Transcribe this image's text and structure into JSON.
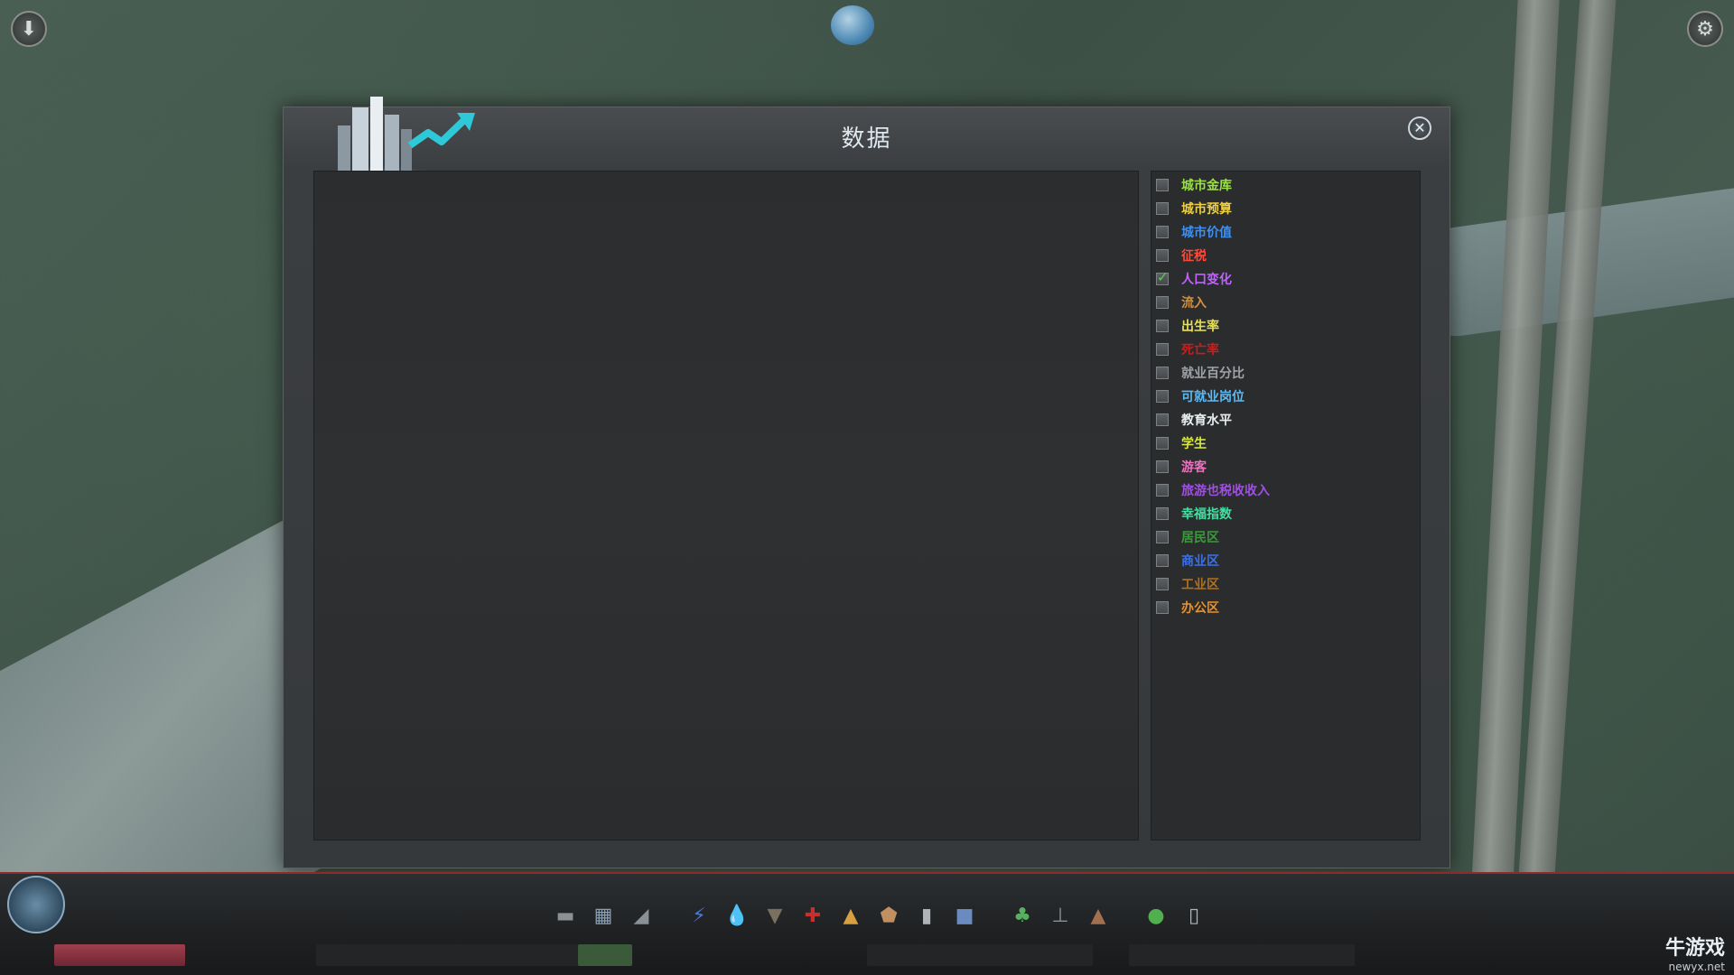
{
  "panel": {
    "title": "数据",
    "close_label": "✕"
  },
  "legend": {
    "items": [
      {
        "label": "城市金库",
        "color": "#9be04a",
        "checked": false
      },
      {
        "label": "城市预算",
        "color": "#f0d040",
        "checked": false
      },
      {
        "label": "城市价值",
        "color": "#3f8ff0",
        "checked": false
      },
      {
        "label": "征税",
        "color": "#ff4a3a",
        "checked": false
      },
      {
        "label": "人口变化",
        "color": "#c060ff",
        "checked": true
      },
      {
        "label": "流入",
        "color": "#d09040",
        "checked": false
      },
      {
        "label": "出生率",
        "color": "#e6e050",
        "checked": false
      },
      {
        "label": "死亡率",
        "color": "#c81e1e",
        "checked": false
      },
      {
        "label": "就业百分比",
        "color": "#a0a4a8",
        "checked": false
      },
      {
        "label": "可就业岗位",
        "color": "#60b8f0",
        "checked": false
      },
      {
        "label": "教育水平",
        "color": "#e8eef0",
        "checked": false
      },
      {
        "label": "学生",
        "color": "#d8e840",
        "checked": false
      },
      {
        "label": "游客",
        "color": "#f070c0",
        "checked": false
      },
      {
        "label": "旅游也税收收入",
        "color": "#a050e0",
        "checked": false
      },
      {
        "label": "幸福指数",
        "color": "#40e0a0",
        "checked": false
      },
      {
        "label": "居民区",
        "color": "#3a9a3a",
        "checked": false
      },
      {
        "label": "商业区",
        "color": "#3a70e8",
        "checked": false
      },
      {
        "label": "工业区",
        "color": "#b07020",
        "checked": false
      },
      {
        "label": "办公区",
        "color": "#e8902a",
        "checked": false
      }
    ]
  },
  "toolbar": {
    "tools": [
      {
        "name": "roads-icon",
        "glyph": "▬",
        "color": "#8a9094"
      },
      {
        "name": "zoning-icon",
        "glyph": "▦",
        "color": "#8aa0b4"
      },
      {
        "name": "districts-icon",
        "glyph": "◢",
        "color": "#8a9094"
      },
      {
        "name": "electricity-icon",
        "glyph": "⚡",
        "color": "#4a7ad8"
      },
      {
        "name": "water-icon",
        "glyph": "💧",
        "color": "#4a8ad8"
      },
      {
        "name": "garbage-icon",
        "glyph": "▼",
        "color": "#7a7060"
      },
      {
        "name": "healthcare-icon",
        "glyph": "✚",
        "color": "#c83030"
      },
      {
        "name": "fire-icon",
        "glyph": "▲",
        "color": "#d8a040"
      },
      {
        "name": "police-icon",
        "glyph": "⬟",
        "color": "#c09060"
      },
      {
        "name": "education-icon",
        "glyph": "▮",
        "color": "#b0b4b8"
      },
      {
        "name": "transport-icon",
        "glyph": "■",
        "color": "#6a8ac0"
      },
      {
        "name": "beautification-icon",
        "glyph": "♣",
        "color": "#5ab060"
      },
      {
        "name": "monuments-icon",
        "glyph": "⊥",
        "color": "#8a9094"
      },
      {
        "name": "wonders-icon",
        "glyph": "▲",
        "color": "#a07050"
      },
      {
        "name": "bulldozer-icon",
        "glyph": "●",
        "color": "#50b050"
      },
      {
        "name": "policies-icon",
        "glyph": "▯",
        "color": "#b0b4b8"
      }
    ]
  },
  "watermark": {
    "title": "牛游戏",
    "url": "newyx.net"
  }
}
